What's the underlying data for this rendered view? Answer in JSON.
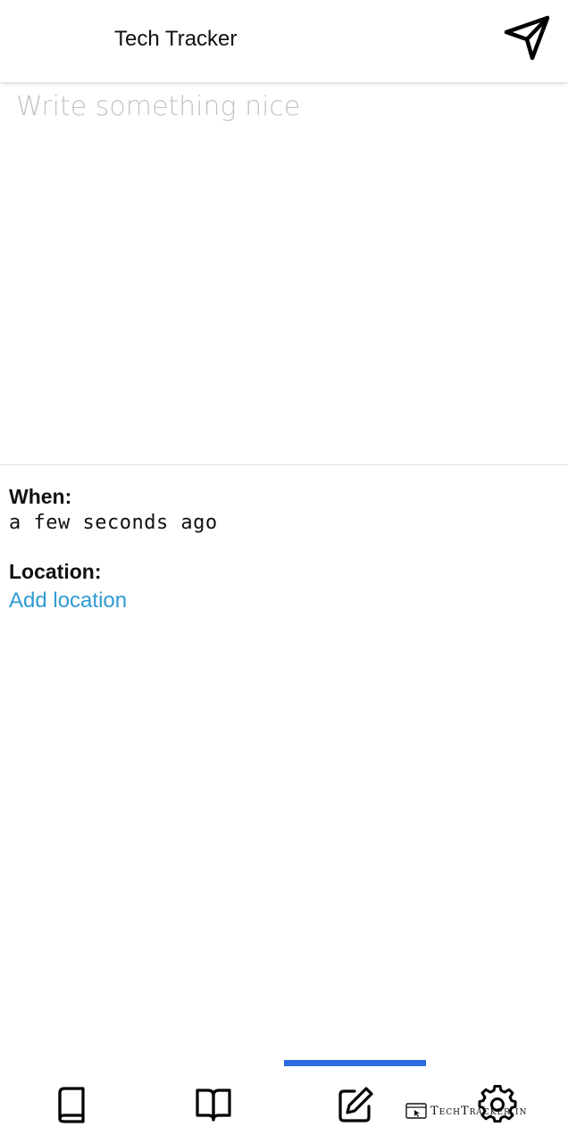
{
  "header": {
    "title": "Tech Tracker",
    "send_icon": "send-paper-plane-icon"
  },
  "editor": {
    "placeholder": "Write something nice",
    "value": ""
  },
  "details": {
    "when_label": "When:",
    "when_value": "a few seconds ago",
    "location_label": "Location:",
    "location_link": "Add location"
  },
  "bottom_nav": {
    "active_index": 2,
    "indicator_color": "#2d6be2",
    "items": [
      {
        "icon": "book-icon"
      },
      {
        "icon": "open-book-icon"
      },
      {
        "icon": "edit-icon"
      },
      {
        "icon": "gear-icon"
      }
    ]
  },
  "watermark": {
    "text": "TechTracker.in"
  },
  "colors": {
    "link": "#2f9bd1",
    "placeholder": "#c4c4c4",
    "accent": "#2d6be2"
  }
}
